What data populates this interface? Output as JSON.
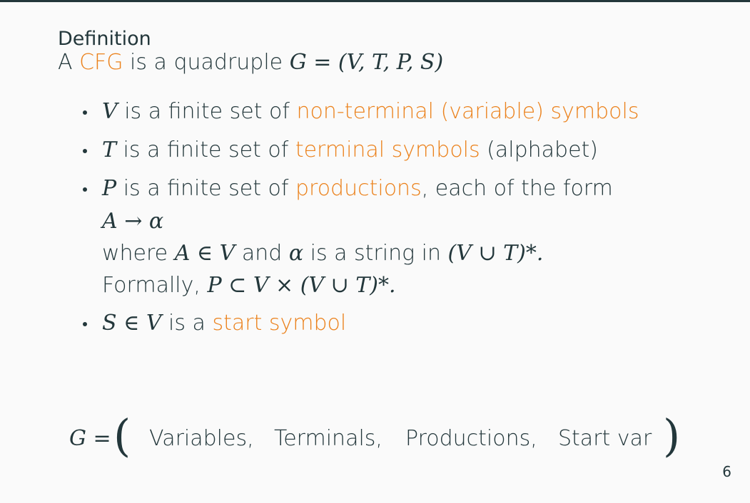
{
  "slide": {
    "title": "Definition",
    "intro": {
      "prefix": "A ",
      "cfg": "CFG",
      "middle": " is a quadruple ",
      "tuple": "G = (V, T, P, S)"
    },
    "bullets": [
      {
        "var": "V",
        "text": " is a finite set of ",
        "highlight": "non-terminal (variable) symbols",
        "suffix": ""
      },
      {
        "var": "T",
        "text": " is a finite set of ",
        "highlight": "terminal symbols",
        "suffix": " (alphabet)"
      },
      {
        "var": "P",
        "text": " is a finite set of ",
        "highlight": "productions",
        "suffix": ", each of the form"
      },
      {
        "var": "S ∈ V",
        "text": " is a ",
        "highlight": "start symbol",
        "suffix": ""
      }
    ],
    "production_form": "A → α",
    "where_line": {
      "w1": "where ",
      "m1": "A ∈ V",
      "w2": " and ",
      "m2": "α",
      "w3": " is a string in ",
      "m3": "(V ∪ T)*."
    },
    "formally_line": {
      "w1": "Formally, ",
      "m1": "P ⊂ V × (V ∪ T)*."
    },
    "tuple_summary": {
      "lhs": "G =",
      "open": "(",
      "items": [
        "Variables,",
        "Terminals,",
        "Productions,",
        "Start var"
      ],
      "close": ")"
    },
    "page_number": "6"
  },
  "colors": {
    "accent": "#eb811b",
    "text": "#23373b",
    "background": "#fafafa"
  }
}
